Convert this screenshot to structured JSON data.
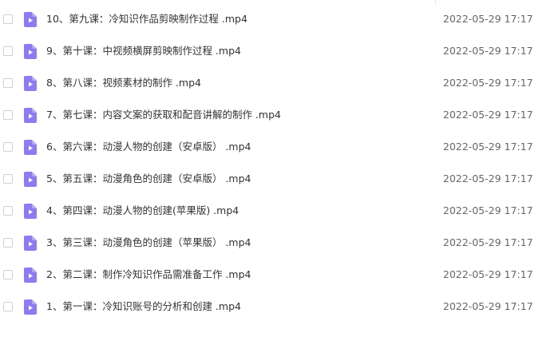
{
  "accent_color": "#8c7cf0",
  "file_icon": "video-file-icon",
  "files": [
    {
      "name": "10、第九课：冷知识作品剪映制作过程 .mp4",
      "date": "2022-05-29 17:17"
    },
    {
      "name": "9、第十课：中视频横屏剪映制作过程 .mp4",
      "date": "2022-05-29 17:17"
    },
    {
      "name": "8、第八课：视频素材的制作 .mp4",
      "date": "2022-05-29 17:17"
    },
    {
      "name": "7、第七课：内容文案的获取和配音讲解的制作 .mp4",
      "date": "2022-05-29 17:17"
    },
    {
      "name": "6、第六课：动漫人物的创建（安卓版） .mp4",
      "date": "2022-05-29 17:17"
    },
    {
      "name": "5、第五课：动漫角色的创建（安卓版） .mp4",
      "date": "2022-05-29 17:17"
    },
    {
      "name": "4、第四课：动漫人物的创建(苹果版) .mp4",
      "date": "2022-05-29 17:17"
    },
    {
      "name": "3、第三课：动漫角色的创建（苹果版） .mp4",
      "date": "2022-05-29 17:17"
    },
    {
      "name": "2、第二课：制作冷知识作品需准备工作 .mp4",
      "date": "2022-05-29 17:17"
    },
    {
      "name": "1、第一课：冷知识账号的分析和创建 .mp4",
      "date": "2022-05-29 17:17"
    }
  ]
}
